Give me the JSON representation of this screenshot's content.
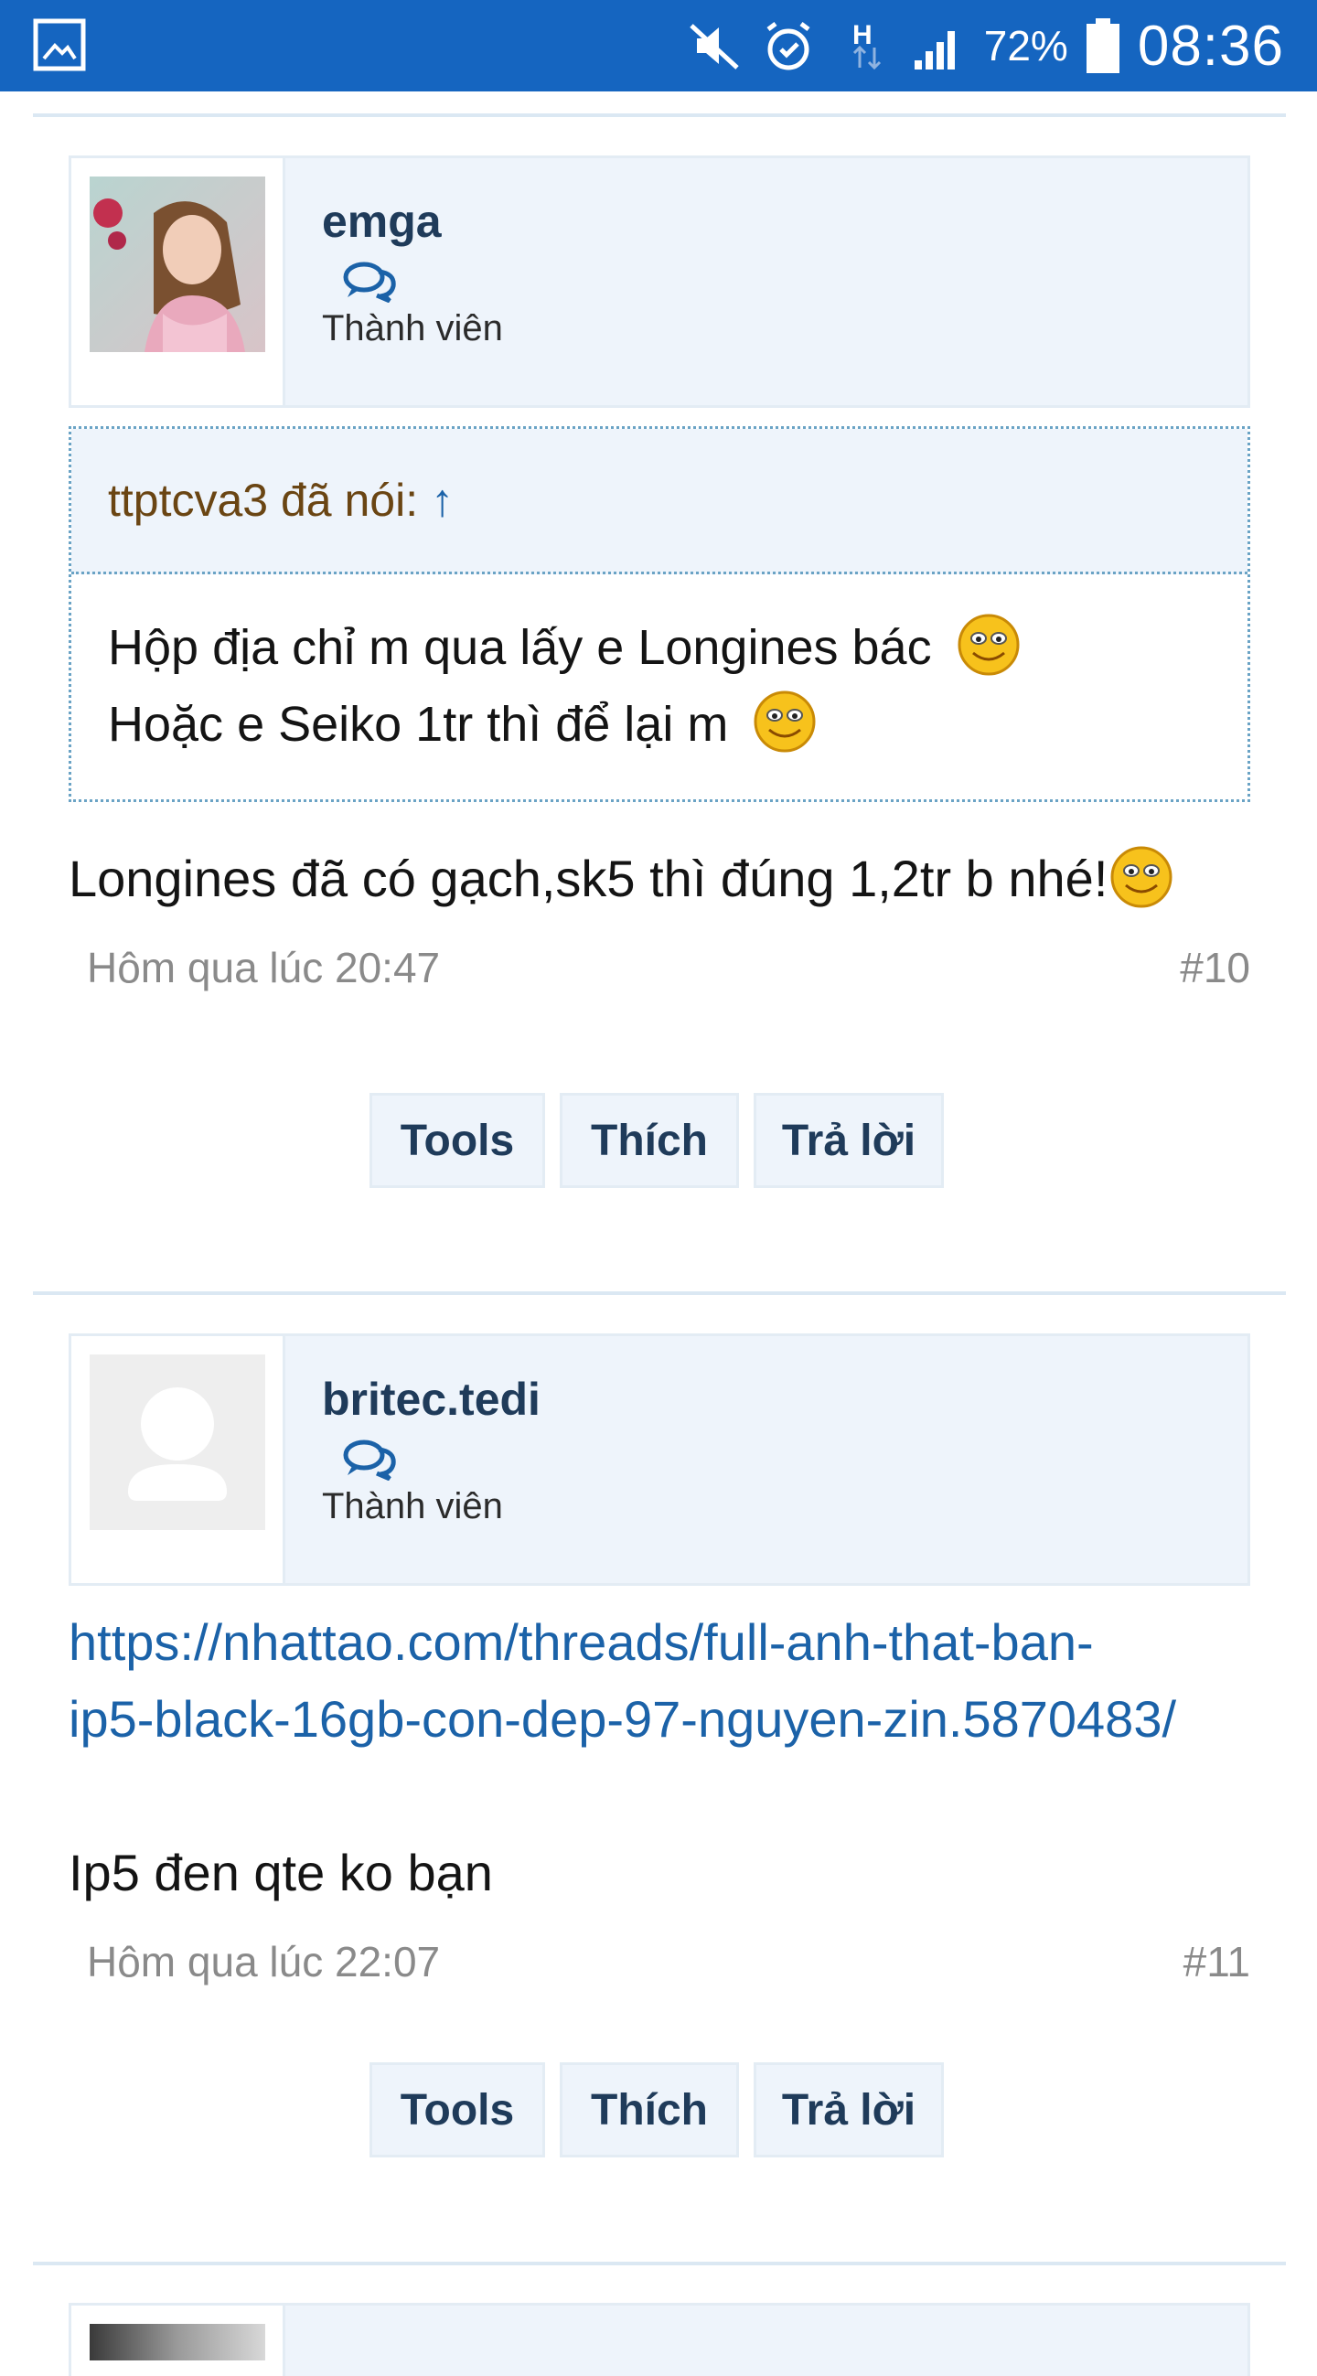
{
  "status_bar": {
    "icons": [
      "gallery-icon",
      "mute-icon",
      "alarm-icon",
      "network-h-icon",
      "signal-icon",
      "battery-icon"
    ],
    "battery": "72%",
    "time": "08:36"
  },
  "posts": [
    {
      "username": "emga",
      "user_title": "Thành viên",
      "avatar": "girl-photo",
      "quote": {
        "author": "ttptcva3 đã nói:",
        "arrow": "↑",
        "line1": "Hộp địa chỉ m qua lấy e Longines bác",
        "line2": "Hoặc e Seiko 1tr thì để lại m"
      },
      "message": "Longines đã có gạch,sk5 thì đúng 1,2tr b nhé!",
      "date": "Hôm qua lúc 20:47",
      "number": "#10",
      "actions": {
        "tools": "Tools",
        "like": "Thích",
        "reply": "Trả lời"
      }
    },
    {
      "username": "britec.tedi",
      "user_title": "Thành viên",
      "avatar": "default-avatar",
      "link_line1": "https://nhattao.com/threads/full-anh-that-ban-",
      "link_line2": "ip5-black-16gb-con-dep-97-nguyen-zin.5870483/",
      "message": "Ip5 đen qte ko bạn",
      "date": "Hôm qua lúc 22:07",
      "number": "#11",
      "actions": {
        "tools": "Tools",
        "like": "Thích",
        "reply": "Trả lời"
      }
    }
  ],
  "colors": {
    "status_bar": "#1565c0",
    "card_bg": "#eef4fb",
    "link": "#1b62a8",
    "username": "#1f3b5a",
    "quote_author": "#6a4513"
  }
}
